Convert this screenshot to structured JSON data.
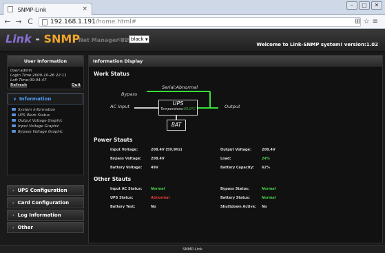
{
  "browser": {
    "tab_title": "SNMP-Link",
    "tab_close": "×",
    "back": "←",
    "forward": "→",
    "reload": "C",
    "url_host": "192.168.1.191",
    "url_path": "/home.html#",
    "menu_glyph": "≡"
  },
  "header": {
    "logo_link": "Link",
    "logo_dash": " - ",
    "logo_snmp": "SNMP",
    "app_name": "Net Manager 82X",
    "style_label": "Style",
    "style_value": "black",
    "welcome": "Welcome to Link-SNMP system! version:1.02"
  },
  "user_panel": {
    "title": "User Information",
    "user": "User:admin",
    "login_time": "Login Time:2000-10-26 22:11",
    "left_time": "Left Time:00:04:47",
    "refresh": "Refresh",
    "quit": "Quit"
  },
  "nav": {
    "active": "Information",
    "subitems": [
      "System Information",
      "UPS Work Status",
      "Output Voltage Graphic",
      "Input Voltage Graphic",
      "Bypass Voltage Graphic"
    ],
    "items": [
      "UPS Configuration",
      "Card Configuration",
      "Log Information",
      "Other"
    ]
  },
  "main": {
    "panel_title": "Information Display",
    "work_status_title": "Work Status",
    "diagram": {
      "serial_label": "Serial:Abnormal",
      "bypass": "Bypass",
      "ac_input": "AC Input",
      "ups": "UPS",
      "temperature_label": "Temperature:",
      "temperature_value": "35.0°C",
      "output": "Output",
      "bat": "BAT"
    },
    "power_status_title": "Power Stauts",
    "power_rows": [
      {
        "l1": "Input Voltage:",
        "v1": "208.4V (59.9Hz)",
        "l2": "Output Voltage:",
        "v2": "208.4V"
      },
      {
        "l1": "Bypass Voltage:",
        "v1": "208.4V",
        "l2": "Load:",
        "v2": "24%"
      },
      {
        "l1": "Battery Voltage:",
        "v1": "49V",
        "l2": "Battery Capacity:",
        "v2": "62%"
      }
    ],
    "other_status_title": "Other Stauts",
    "other_rows": [
      {
        "l1": "Input AC Status:",
        "v1": "Normal",
        "l2": "Bypass Status:",
        "v2": "Normal"
      },
      {
        "l1": "UPS Status:",
        "v1": "Abnormal",
        "l2": "Battery Status:",
        "v2": "Normal"
      },
      {
        "l1": "Battery Test:",
        "v1": "No",
        "l2": "Shuttdown Active:",
        "v2": "No"
      }
    ]
  },
  "footer": {
    "text": "SNMP-Link"
  },
  "colors": {
    "accent_blue": "#4da3ff",
    "ok_green": "#4ad04a",
    "error_red": "#e83a3a",
    "logo_orange": "#f0a52a",
    "logo_purple": "#8a6fd4"
  }
}
